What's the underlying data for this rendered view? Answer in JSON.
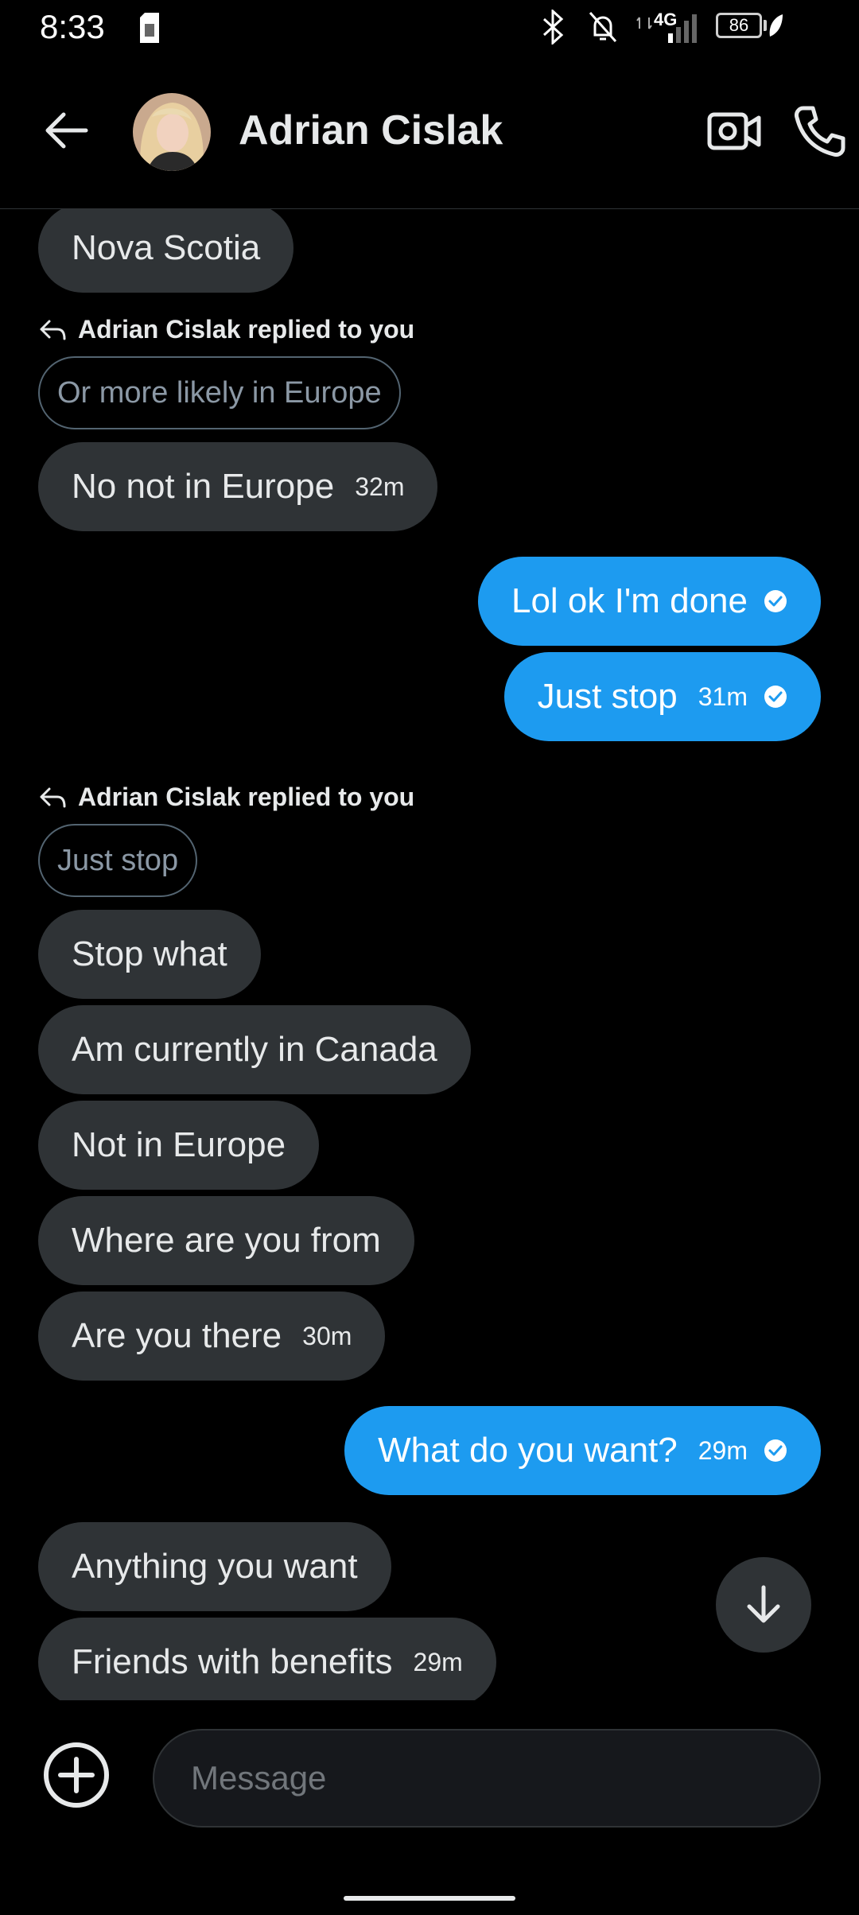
{
  "status_bar": {
    "time": "8:33",
    "network": "4G",
    "battery": "86"
  },
  "header": {
    "contact_name": "Adrian Cislak"
  },
  "messages": [
    {
      "type": "received",
      "text": "Nova Scotia",
      "time": ""
    },
    {
      "type": "reply_label",
      "text": "Adrian Cislak replied to you"
    },
    {
      "type": "quote",
      "text": "Or more likely in Europe"
    },
    {
      "type": "received",
      "text": "No not in Europe",
      "time": "32m"
    },
    {
      "type": "sent",
      "text": "Lol ok I'm done",
      "time": ""
    },
    {
      "type": "sent",
      "text": "Just stop",
      "time": "31m"
    },
    {
      "type": "reply_label",
      "text": "Adrian Cislak replied to you"
    },
    {
      "type": "quote",
      "text": "Just stop"
    },
    {
      "type": "received",
      "text": "Stop what",
      "time": ""
    },
    {
      "type": "received",
      "text": "Am currently in Canada",
      "time": ""
    },
    {
      "type": "received",
      "text": "Not in Europe",
      "time": ""
    },
    {
      "type": "received",
      "text": "Where are you from",
      "time": ""
    },
    {
      "type": "received",
      "text": "Are you there",
      "time": "30m"
    },
    {
      "type": "sent",
      "text": "What do you want?",
      "time": "29m"
    },
    {
      "type": "received",
      "text": "Anything you want",
      "time": ""
    },
    {
      "type": "received",
      "text": "Friends with benefits",
      "time": "29m"
    }
  ],
  "composer": {
    "placeholder": "Message"
  },
  "colors": {
    "sent_bubble": "#1d9bf0",
    "received_bubble": "#2f3336",
    "background": "#000000"
  }
}
